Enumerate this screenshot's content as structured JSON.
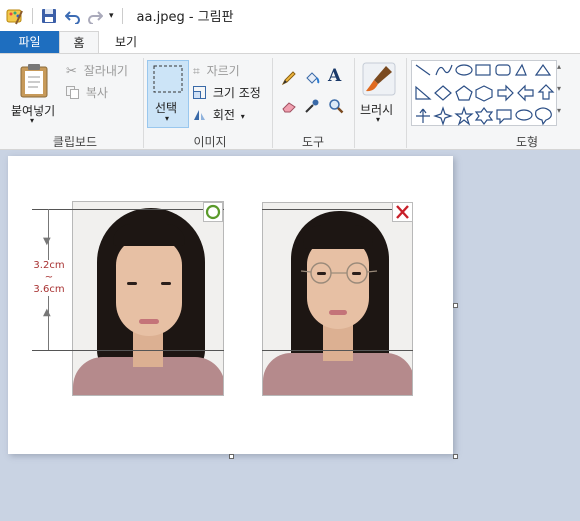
{
  "window": {
    "title": "aa.jpeg - 그림판"
  },
  "tabs": {
    "file": "파일",
    "home": "홈",
    "view": "보기"
  },
  "clipboard": {
    "paste": "붙여넣기",
    "cut": "잘라내기",
    "copy": "복사",
    "group": "클립보드"
  },
  "image": {
    "select": "선택",
    "crop": "자르기",
    "resize": "크기 조정",
    "rotate": "회전",
    "group": "이미지"
  },
  "tools": {
    "group": "도구"
  },
  "brushes": {
    "label": "브러시"
  },
  "shapes": {
    "group": "도형"
  },
  "annotation": {
    "top": "3.2cm",
    "tilde": "~",
    "bottom": "3.6cm"
  },
  "colors": {
    "accent": "#1e6ebf",
    "ok": "#5a9a2a",
    "bad": "#c8202a",
    "annotation": "#a83232"
  }
}
